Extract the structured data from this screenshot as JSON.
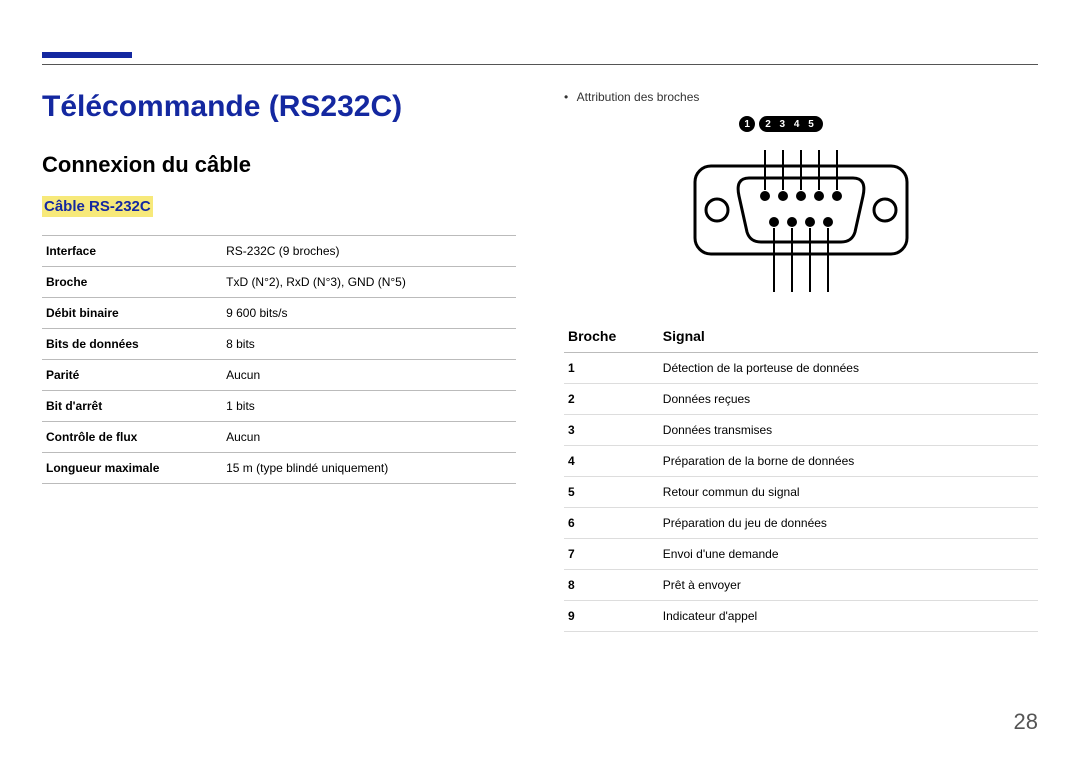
{
  "title": "Télécommande (RS232C)",
  "section": "Connexion du câble",
  "subsection": "Câble RS-232C",
  "spec_table": [
    {
      "k": "Interface",
      "v": "RS-232C (9 broches)"
    },
    {
      "k": "Broche",
      "v": "TxD (N°2), RxD (N°3), GND (N°5)"
    },
    {
      "k": "Débit binaire",
      "v": "9 600 bits/s"
    },
    {
      "k": "Bits de données",
      "v": "8 bits"
    },
    {
      "k": "Parité",
      "v": "Aucun"
    },
    {
      "k": "Bit d'arrêt",
      "v": "1 bits"
    },
    {
      "k": "Contrôle de flux",
      "v": "Aucun"
    },
    {
      "k": "Longueur maximale",
      "v": "15 m (type blindé uniquement)"
    }
  ],
  "bullet": "Attribution des broches",
  "pin_badges": {
    "first": "1",
    "rest": "2 3 4 5"
  },
  "pin_table": {
    "headers": {
      "pin": "Broche",
      "signal": "Signal"
    },
    "rows": [
      {
        "pin": "1",
        "signal": "Détection de la porteuse de données"
      },
      {
        "pin": "2",
        "signal": "Données reçues"
      },
      {
        "pin": "3",
        "signal": "Données transmises"
      },
      {
        "pin": "4",
        "signal": "Préparation de la borne de données"
      },
      {
        "pin": "5",
        "signal": "Retour commun du signal"
      },
      {
        "pin": "6",
        "signal": "Préparation du jeu de données"
      },
      {
        "pin": "7",
        "signal": "Envoi d'une demande"
      },
      {
        "pin": "8",
        "signal": "Prêt à envoyer"
      },
      {
        "pin": "9",
        "signal": "Indicateur d'appel"
      }
    ]
  },
  "page_number": "28"
}
